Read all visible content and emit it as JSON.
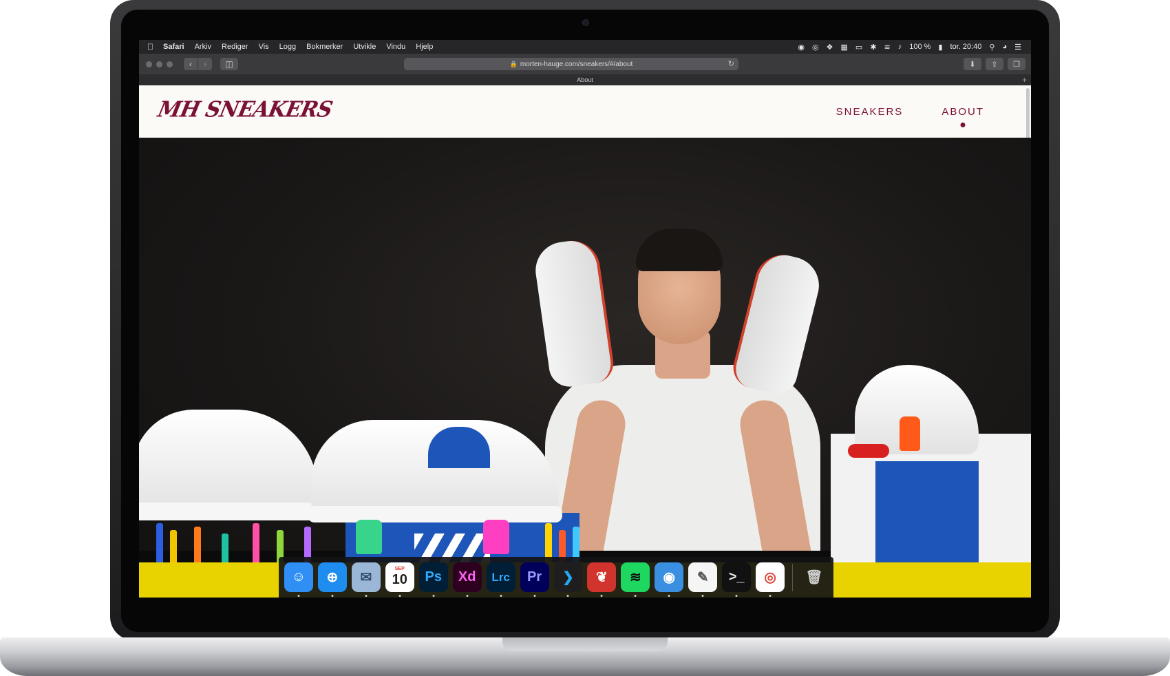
{
  "menubar": {
    "app_name": "Safari",
    "items": [
      "Arkiv",
      "Rediger",
      "Vis",
      "Logg",
      "Bokmerker",
      "Utvikle",
      "Vindu",
      "Hjelp"
    ],
    "battery": "100 %",
    "clock": "tor. 20:40"
  },
  "browser": {
    "url": "morten-hauge.com/sneakers/#/about",
    "tab_title": "About"
  },
  "site": {
    "logo": "MH SNEAKERS",
    "nav": [
      {
        "label": "SNEAKERS",
        "active": false
      },
      {
        "label": "ABOUT",
        "active": true
      }
    ],
    "brand_color": "#7a1238",
    "accent_yellow": "#e8d200"
  },
  "dock": {
    "apps": [
      {
        "name": "finder-icon",
        "glyph": "☺",
        "bg": "#2f8ff5",
        "fg": "#ffffff"
      },
      {
        "name": "safari-icon",
        "glyph": "⊕",
        "bg": "#1f8cf0",
        "fg": "#ffffff"
      },
      {
        "name": "preview-icon",
        "glyph": "✉",
        "bg": "#9bb7d8",
        "fg": "#304a6e"
      },
      {
        "name": "calendar-icon",
        "glyph": "10",
        "bg": "#ffffff",
        "fg": "#222222",
        "label_top": "SEP"
      },
      {
        "name": "photoshop-icon",
        "glyph": "Ps",
        "bg": "#001e36",
        "fg": "#31a8ff"
      },
      {
        "name": "xd-icon",
        "glyph": "Xd",
        "bg": "#2e001f",
        "fg": "#ff61f6"
      },
      {
        "name": "lightroom-classic-icon",
        "glyph": "Lrc",
        "bg": "#001e36",
        "fg": "#31a8ff"
      },
      {
        "name": "premiere-icon",
        "glyph": "Pr",
        "bg": "#00005b",
        "fg": "#9999ff"
      },
      {
        "name": "vscode-icon",
        "glyph": "❯",
        "bg": "#1e1e1e",
        "fg": "#23a9f2"
      },
      {
        "name": "petal-app-icon",
        "glyph": "❦",
        "bg": "#d0342c",
        "fg": "#ffffff"
      },
      {
        "name": "spotify-icon",
        "glyph": "≋",
        "bg": "#1ed760",
        "fg": "#111111"
      },
      {
        "name": "tweetbot-icon",
        "glyph": "◉",
        "bg": "#3a8fe0",
        "fg": "#ffffff"
      },
      {
        "name": "textedit-icon",
        "glyph": "✎",
        "bg": "#f5f5f5",
        "fg": "#555555"
      },
      {
        "name": "terminal-icon",
        "glyph": ">_",
        "bg": "#111111",
        "fg": "#e8e8e8"
      },
      {
        "name": "chrome-icon",
        "glyph": "◎",
        "bg": "#ffffff",
        "fg": "#db4437"
      }
    ],
    "trash": {
      "name": "trash-icon",
      "glyph": "🗑"
    }
  }
}
